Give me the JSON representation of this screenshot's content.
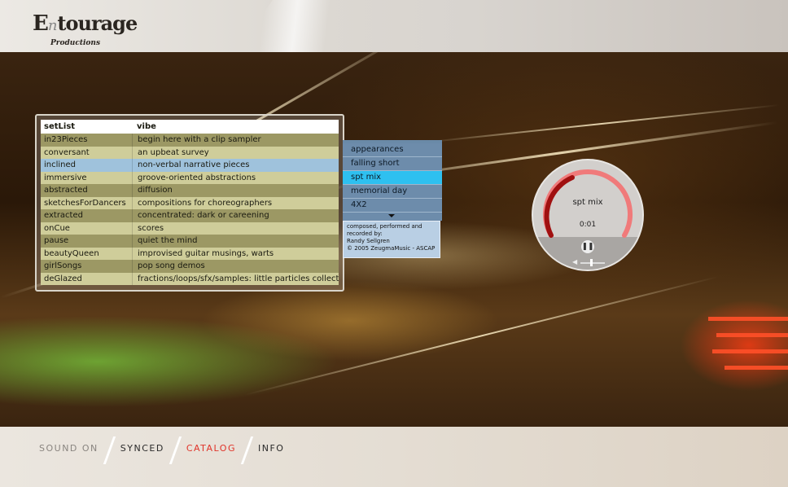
{
  "brand": {
    "logo_e": "E",
    "logo_n": "n",
    "logo_rest": "tourage",
    "logo_sub": "Productions"
  },
  "setlist": {
    "headers": {
      "col1": "setList",
      "col2": "vibe"
    },
    "rows": [
      {
        "name": "in23Pieces",
        "vibe": "begin here with a clip sampler"
      },
      {
        "name": "conversant",
        "vibe": "an upbeat survey"
      },
      {
        "name": "inclined",
        "vibe": "non-verbal narrative pieces"
      },
      {
        "name": "immersive",
        "vibe": "groove-oriented abstractions"
      },
      {
        "name": "abstracted",
        "vibe": "diffusion"
      },
      {
        "name": "sketchesForDancers",
        "vibe": "compositions for choreographers"
      },
      {
        "name": "extracted",
        "vibe": "concentrated:  dark or careening"
      },
      {
        "name": "onCue",
        "vibe": "scores"
      },
      {
        "name": "pause",
        "vibe": "quiet the mind"
      },
      {
        "name": "beautyQueen",
        "vibe": "improvised guitar musings, warts"
      },
      {
        "name": "girlSongs",
        "vibe": "pop song demos"
      },
      {
        "name": "deGlazed",
        "vibe": "fractions/loops/sfx/samples:  little particles collect here"
      }
    ],
    "selected": "inclined"
  },
  "tracks": {
    "items": [
      "appearances",
      "falling short",
      "spt mix",
      "memorial day",
      "4X2"
    ],
    "selected": "spt mix"
  },
  "credits": {
    "line1": "composed, performed and",
    "line2": "recorded by:",
    "line3": "Randy Sellgren",
    "line4": "© 2005 ZeugmaMusic - ASCAP"
  },
  "player": {
    "title": "spt mix",
    "time": "0:01",
    "pause_glyph": "❚❚",
    "volume_glyph": "◀",
    "progress": 0.02,
    "volume": 0.6
  },
  "nav": {
    "sound": "SOUND ON",
    "synced": "SYNCED",
    "catalog": "CATALOG",
    "info": "INFO",
    "active": "CATALOG"
  },
  "colors": {
    "accent": "#e0342a",
    "selected_track": "#2ec0f0",
    "selected_row": "#9fc2dc"
  }
}
